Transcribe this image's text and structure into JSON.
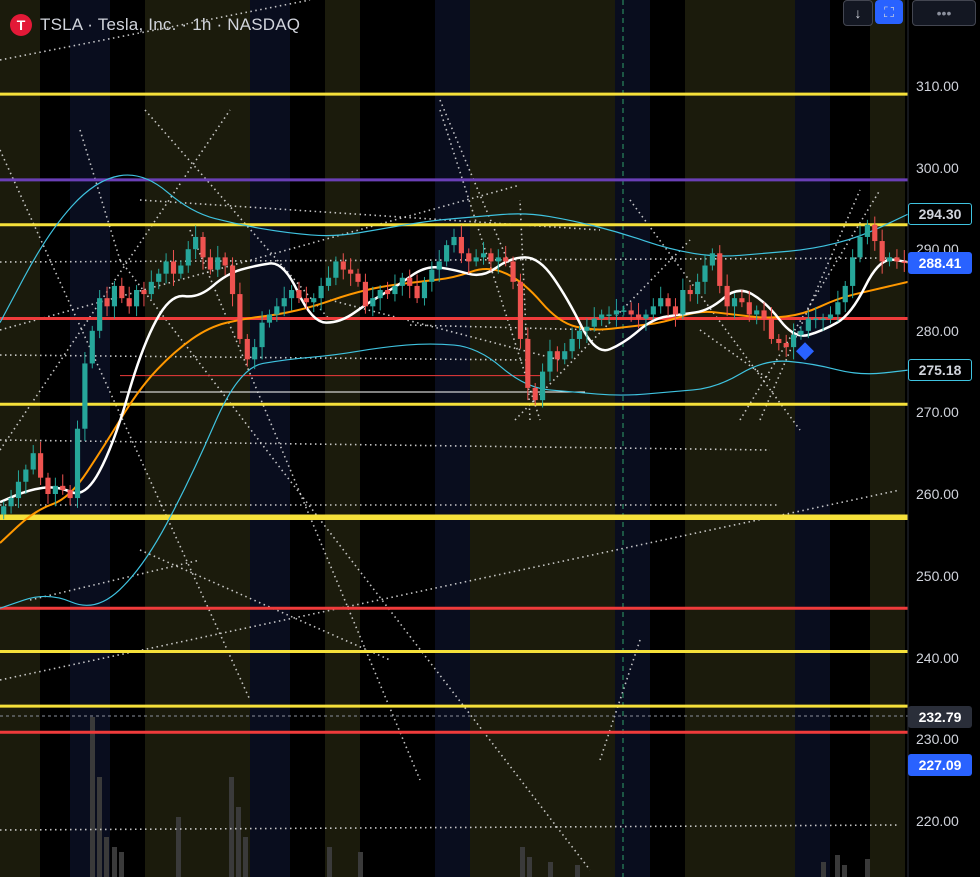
{
  "header": {
    "logo_glyph": "T",
    "title": "TSLA · Tesla, Inc. · 1h · NASDAQ"
  },
  "toolbar": {
    "down_glyph": "↓",
    "fullscreen_glyph": "⛶",
    "more_glyph": "•••"
  },
  "price_axis": {
    "labels": [
      "310.00",
      "300.00",
      "290.00",
      "280.00",
      "270.00",
      "260.00",
      "250.00",
      "240.00",
      "230.00",
      "220.00"
    ]
  },
  "price_tags": {
    "bb_upper": "294.30",
    "last_price": "288.41",
    "bb_lower": "275.18",
    "level_a": "232.79",
    "level_b": "227.09"
  },
  "colors": {
    "background": "#000000",
    "session_shade": "#1b1b0c",
    "session_blue": "#090d1e",
    "up_candle": "#26a69a",
    "down_candle": "#ef5350",
    "ma_fast": "#ffffff",
    "ma_slow": "#ff9800",
    "bollinger": "#3fc3e0",
    "level_yellow": "#f5e03a",
    "level_red": "#ef3b3b",
    "level_purple": "#6a3fb7",
    "dotted_lines": "#e6e6e6",
    "cursor_line": "#2f9e6a",
    "marker": "#2962ff"
  },
  "chart_data": {
    "type": "candlestick",
    "symbol": "TSLA",
    "interval": "1h",
    "exchange": "NASDAQ",
    "ylim": [
      217,
      321
    ],
    "y_ticks": [
      310,
      300,
      290,
      280,
      270,
      260,
      250,
      240,
      230,
      220
    ],
    "grid": false,
    "candles_close": [
      258.5,
      259.5,
      261.5,
      263,
      265,
      262,
      260,
      261,
      260.5,
      259.5,
      268,
      276,
      280,
      284,
      283,
      285.5,
      284,
      283,
      285,
      284.5,
      286,
      287,
      288.5,
      287,
      288,
      290,
      291.5,
      289,
      287.5,
      289,
      288,
      284.5,
      279,
      276.5,
      278,
      281,
      282,
      283,
      284,
      285,
      284,
      283.5,
      284,
      285.5,
      286.5,
      288.5,
      287.5,
      287,
      286,
      283,
      284,
      285,
      284.5,
      285.5,
      286.5,
      285.5,
      284,
      286,
      287.5,
      288.5,
      290.5,
      291.5,
      289.5,
      288.5,
      289,
      289.5,
      288.5,
      289,
      288.5,
      286,
      279,
      273,
      271.5,
      275,
      277.5,
      276.5,
      277.5,
      279,
      280,
      280.5,
      281.5,
      282,
      282,
      282.5,
      282.5,
      282,
      281.5,
      282,
      283,
      284,
      283,
      282,
      285,
      284.5,
      286,
      288,
      289.5,
      285.5,
      283,
      284,
      283.5,
      282,
      282.5,
      281.5,
      279,
      278.5,
      278,
      279.5,
      280,
      281.5,
      281.5,
      281.5,
      282,
      283.5,
      285.5,
      289,
      291.5,
      293,
      291,
      288.5,
      289,
      288.5,
      288.41
    ],
    "ma_fast_samples": [
      259,
      260.5,
      261,
      259.5,
      266,
      278,
      284.5,
      284,
      287,
      288,
      288.5,
      281,
      281,
      283.5,
      285.5,
      288,
      287.5,
      286.5,
      289,
      289,
      284,
      277,
      278.5,
      281.5,
      282,
      282.5,
      285.5,
      283.5,
      279,
      280,
      282,
      289,
      288.41
    ],
    "ma_slow_samples": [
      254,
      258,
      259.5,
      266,
      273,
      277.5,
      280.5,
      281.5,
      282,
      283,
      284.5,
      285.5,
      286,
      286.5,
      288,
      286,
      281,
      280,
      280.5,
      281,
      282.5,
      282,
      281.5,
      282,
      284,
      285,
      286
    ],
    "bb_upper_samples": [
      281,
      292,
      298.5,
      299.5,
      294.5,
      293,
      292,
      291.5,
      292.5,
      293.5,
      294,
      294.5,
      293.5,
      292,
      290,
      289,
      289.5,
      290,
      291.5,
      294.3
    ],
    "bb_lower_samples": [
      246,
      248,
      245.5,
      251,
      262,
      275.5,
      276.5,
      277,
      278,
      278.5,
      278,
      273,
      272.5,
      272,
      272.5,
      273,
      276.5,
      276,
      274.5,
      275.18
    ],
    "horizontal_levels": [
      {
        "price": 309,
        "color": "yellow"
      },
      {
        "price": 298.5,
        "color": "purple"
      },
      {
        "price": 293,
        "color": "yellow"
      },
      {
        "price": 281.5,
        "color": "red"
      },
      {
        "price": 271,
        "color": "yellow"
      },
      {
        "price": 257.3,
        "color": "yellow"
      },
      {
        "price": 257,
        "color": "yellow"
      },
      {
        "price": 246,
        "color": "red"
      },
      {
        "price": 240.7,
        "color": "yellow"
      },
      {
        "price": 234,
        "color": "yellow"
      },
      {
        "price": 230.8,
        "color": "red"
      }
    ]
  }
}
